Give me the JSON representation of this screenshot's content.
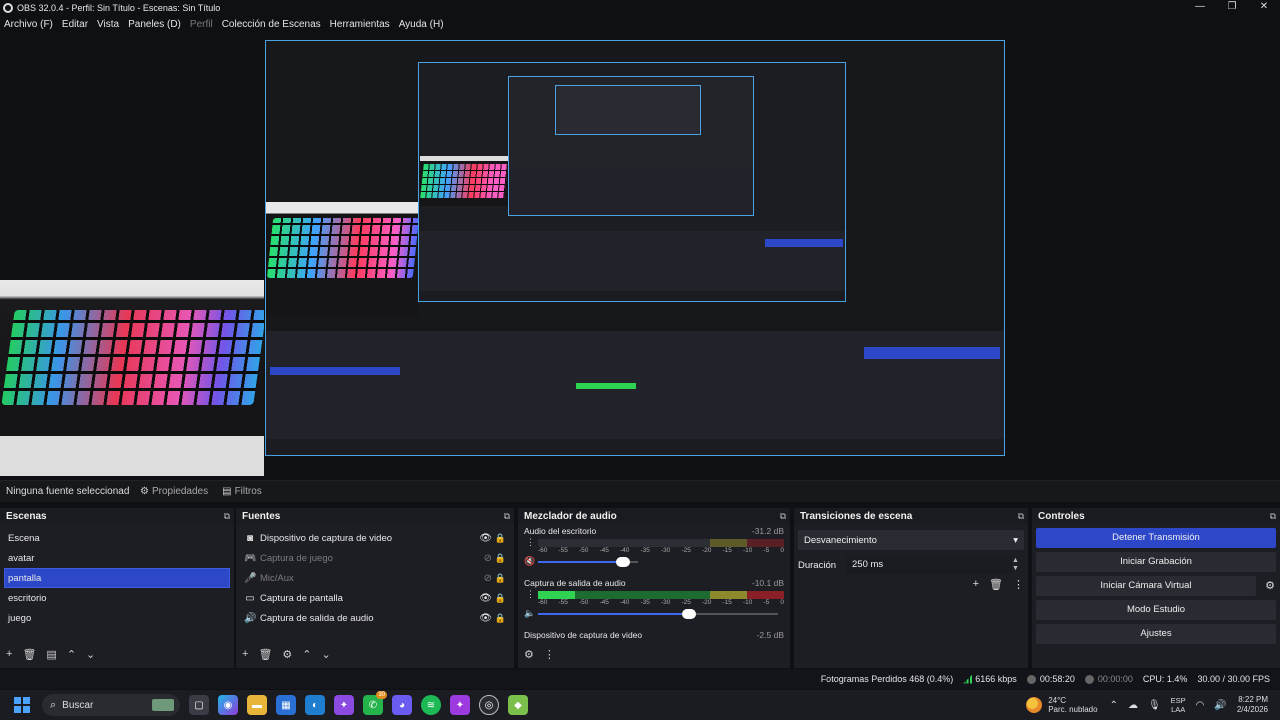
{
  "window": {
    "title": "OBS 32.0.4 - Perfil: Sin Título - Escenas: Sin Título",
    "controls": [
      "—",
      "❐",
      "✕"
    ]
  },
  "menu": [
    "Archivo (F)",
    "Editar",
    "Vista",
    "Paneles (D)",
    "Perfil",
    "Colección de Escenas",
    "Herramientas",
    "Ayuda (H)"
  ],
  "source_toolbar": {
    "no_source": "Ninguna fuente seleccionad",
    "properties": "Propiedades",
    "filters": "Filtros"
  },
  "scenes": {
    "title": "Escenas",
    "items": [
      "Escena",
      "avatar",
      "pantalla",
      "escritorio",
      "juego"
    ],
    "selected": "pantalla"
  },
  "sources": {
    "title": "Fuentes",
    "items": [
      {
        "label": "Dispositivo de captura de video",
        "icon": "camera-icon",
        "visible": true
      },
      {
        "label": "Captura de juego",
        "icon": "gamepad-icon",
        "visible": false
      },
      {
        "label": "Mic/Aux",
        "icon": "microphone-icon",
        "visible": false
      },
      {
        "label": "Captura de pantalla",
        "icon": "monitor-icon",
        "visible": true
      },
      {
        "label": "Captura de salida de audio",
        "icon": "speaker-icon",
        "visible": true
      }
    ]
  },
  "mixer": {
    "title": "Mezclador de audio",
    "scale": [
      "-60",
      "-55",
      "-50",
      "-45",
      "-40",
      "-35",
      "-30",
      "-25",
      "-20",
      "-15",
      "-10",
      "-5",
      "0"
    ],
    "channels": [
      {
        "name": "Audio del escritorio",
        "db": "-31.2 dB",
        "level": 0.0,
        "volume": 0.85,
        "muted": true
      },
      {
        "name": "Captura de salida de audio",
        "db": "-10.1 dB",
        "level": 0.15,
        "volume": 0.6,
        "muted": false
      },
      {
        "name": "Dispositivo de captura de video",
        "db": "-2.5 dB"
      }
    ]
  },
  "transitions": {
    "title": "Transiciones de escena",
    "selected": "Desvanecimiento",
    "duration_label": "Duración",
    "duration_value": "250 ms"
  },
  "controls": {
    "title": "Controles",
    "buttons": [
      "Detener Transmisión",
      "Iniciar Grabación",
      "Iniciar Cámara Virtual",
      "Modo Estudio",
      "Ajustes"
    ]
  },
  "status": {
    "dropped": "Fotogramas Perdidos 468 (0.4%)",
    "bitrate": "6166 kbps",
    "stream_time": "00:58:20",
    "rec_time": "00:00:00",
    "cpu": "CPU: 1.4%",
    "fps": "30.00 / 30.00 FPS"
  },
  "taskbar": {
    "search": "Buscar",
    "chat_badge": "30",
    "weather_temp": "24°C",
    "weather_desc": "Parc. nublado",
    "lang1": "ESP",
    "lang2": "LAA",
    "time": "8:22 PM",
    "date": "2/4/2026"
  },
  "colors": {
    "accent": "#2c48c9",
    "preview_border": "#4aa3e0"
  }
}
